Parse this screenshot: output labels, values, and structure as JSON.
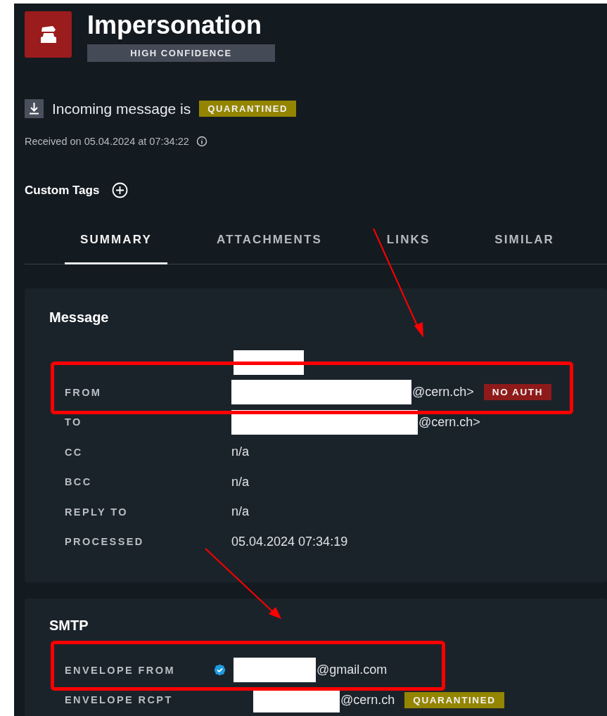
{
  "header": {
    "title": "Impersonation",
    "confidence": "HIGH CONFIDENCE"
  },
  "status": {
    "text": "Incoming message is",
    "badge": {
      "text": "QUARANTINED",
      "kind": "warning"
    }
  },
  "received": "Received on 05.04.2024 at 07:34:22",
  "custom_tags": {
    "label": "Custom Tags"
  },
  "tabs": [
    {
      "label": "SUMMARY",
      "selected": true
    },
    {
      "label": "ATTACHMENTS",
      "selected": false
    },
    {
      "label": "LINKS",
      "selected": false
    },
    {
      "label": "SIMILAR",
      "selected": false
    }
  ],
  "sections": [
    {
      "title": "Message",
      "fields": [
        {
          "redacted": true
        },
        {
          "label": "FROM",
          "redacted": true,
          "value": "@cern.ch>",
          "badge": {
            "text": "NO AUTH",
            "kind": "danger"
          }
        },
        {
          "label": "TO",
          "redacted": true,
          "value": "@cern.ch>"
        },
        {
          "label": "CC",
          "value": "n/a"
        },
        {
          "label": "BCC",
          "value": "n/a"
        },
        {
          "label": "REPLY TO",
          "value": "n/a"
        },
        {
          "label": "PROCESSED",
          "value": "05.04.2024 07:34:19"
        }
      ]
    },
    {
      "title": "SMTP",
      "fields": [
        {
          "label": "ENVELOPE FROM",
          "verified": true,
          "redacted": true,
          "value": "@gmail.com"
        },
        {
          "label": "ENVELOPE RCPT",
          "verified": false,
          "redacted": true,
          "value": "@cern.ch",
          "badge": {
            "text": "QUARANTINED",
            "kind": "warning"
          }
        }
      ]
    }
  ]
}
